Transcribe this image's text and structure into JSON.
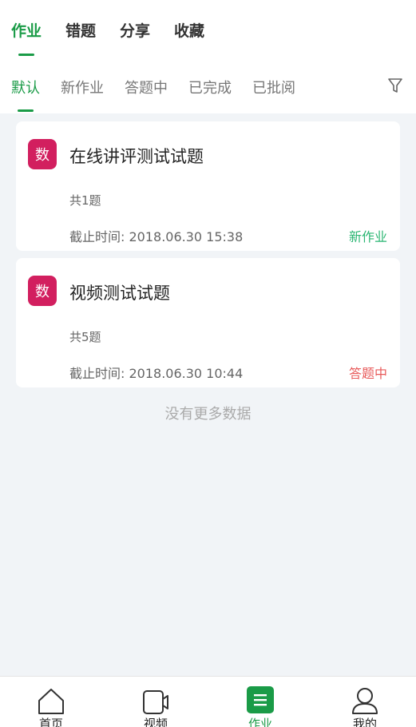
{
  "top_tabs": [
    {
      "label": "作业",
      "active": true
    },
    {
      "label": "错题",
      "active": false
    },
    {
      "label": "分享",
      "active": false
    },
    {
      "label": "收藏",
      "active": false
    }
  ],
  "filter_tabs": [
    {
      "label": "默认",
      "active": true
    },
    {
      "label": "新作业",
      "active": false
    },
    {
      "label": "答题中",
      "active": false
    },
    {
      "label": "已完成",
      "active": false
    },
    {
      "label": "已批阅",
      "active": false
    }
  ],
  "filter_icon": "filter-funnel-icon",
  "assignments": [
    {
      "subject": "数",
      "title": "在线讲评测试试题",
      "count": "共1题",
      "deadline": "截止时间: 2018.06.30   15:38",
      "status": "新作业",
      "status_color": "#2bb673"
    },
    {
      "subject": "数",
      "title": "视频测试试题",
      "count": "共5题",
      "deadline": "截止时间: 2018.06.30   10:44",
      "status": "答题中",
      "status_color": "#e85a5a"
    }
  ],
  "no_more_text": "没有更多数据",
  "bottom_nav": [
    {
      "label": "首页",
      "icon": "home-icon",
      "active": false
    },
    {
      "label": "视频",
      "icon": "video-icon",
      "active": false
    },
    {
      "label": "作业",
      "icon": "homework-icon",
      "active": true
    },
    {
      "label": "我的",
      "icon": "user-icon",
      "active": false
    }
  ],
  "colors": {
    "accent": "#1a9b47",
    "badge": "#d21f5f",
    "background": "#f1f4f7"
  }
}
